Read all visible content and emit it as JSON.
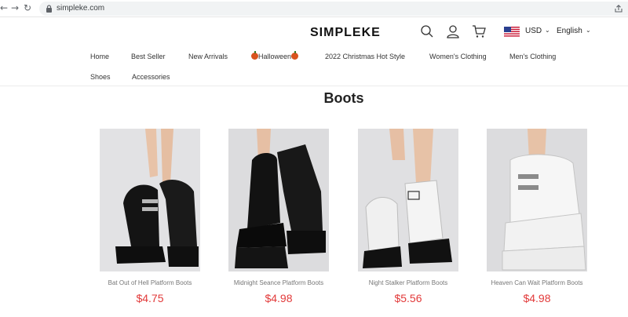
{
  "browser": {
    "url": "simpleke.com"
  },
  "header": {
    "logo": "SIMPLEKE",
    "currency": "USD",
    "language": "English"
  },
  "nav": {
    "home": "Home",
    "best_seller": "Best Seller",
    "new_arrivals": "New Arrivals",
    "halloween": "Halloween",
    "christmas": "2022 Christmas Hot Style",
    "womens": "Women's Clothing",
    "mens": "Men's Clothing",
    "shoes": "Shoes",
    "accessories": "Accessories"
  },
  "page": {
    "title": "Boots"
  },
  "products": [
    {
      "name": "Bat Out of Hell Platform Boots",
      "price": "$4.75",
      "color": "black"
    },
    {
      "name": "Midnight Seance Platform Boots",
      "price": "$4.98",
      "color": "black"
    },
    {
      "name": "Night Stalker Platform Boots",
      "price": "$5.56",
      "color": "white"
    },
    {
      "name": "Heaven Can Wait Platform Boots",
      "price": "$4.98",
      "color": "white"
    }
  ],
  "colors": {
    "price": "#e23a3a",
    "accent": "#d9541e"
  }
}
